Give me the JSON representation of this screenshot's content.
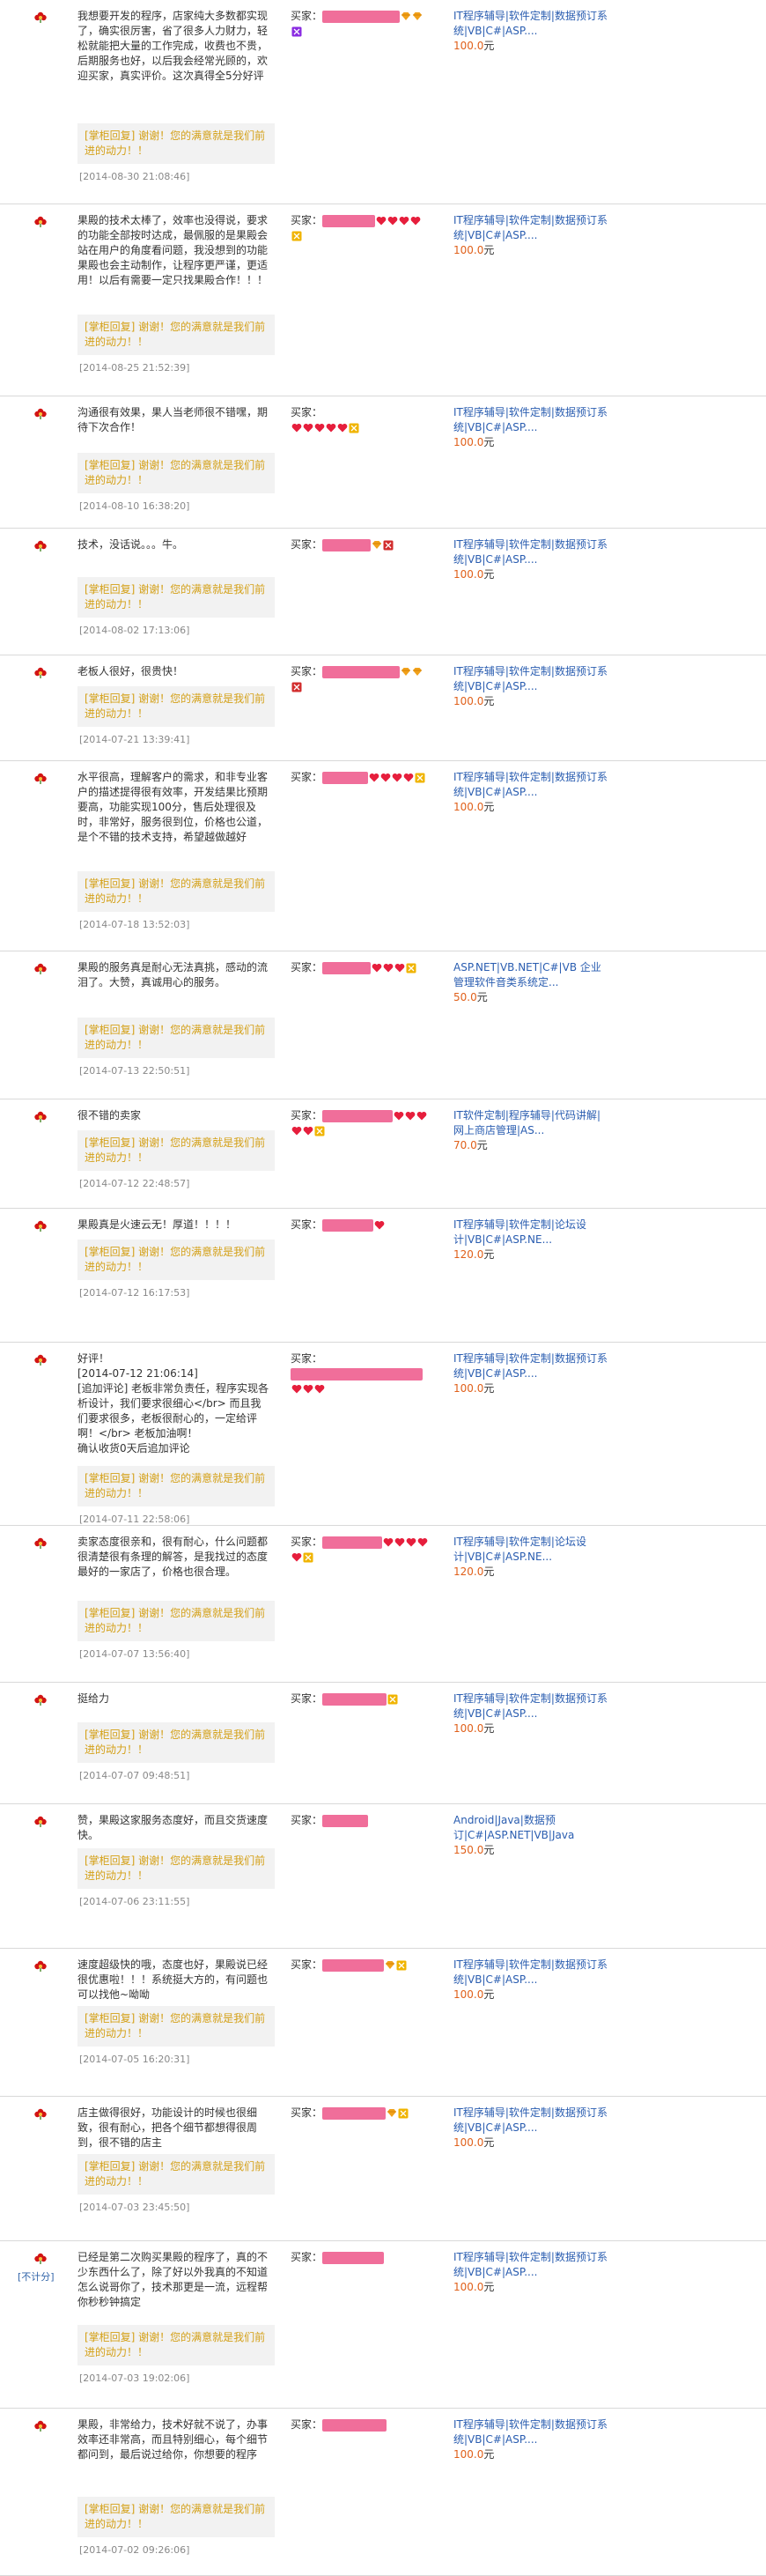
{
  "labels": {
    "buyer": "买家：",
    "price_unit": "元",
    "reply": "[掌柜回复] 谢谢！您的满意就是我们前进的动力！！"
  },
  "colors": {
    "rate_icon": "#cc1111",
    "mask": "#f06e9a",
    "reply_text": "#d4a017",
    "reply_bg": "#f2f2f2",
    "link": "#2a5db0",
    "price": "#e0601a",
    "divider": "#d9d9d9"
  },
  "reviews": [
    {
      "comment": "我想要开发的程序，店家纯大多数都实现了，确实很厉害，省了很多人力财力，轻松就能把大量的工作完成，收费也不贵，后期服务也好，以后我会经常光顾的，欢迎买家，真实评价。这次真得全5分好评",
      "date": "[2014-08-30 21:08:46]",
      "icons": [
        "diamond",
        "diamond",
        "badge-purple"
      ],
      "product": "IT程序辅导|软件定制|数据预订系统|VB|C#|ASP....",
      "price": "100.0"
    },
    {
      "comment": "果殿的技术太棒了，效率也没得说，要求的功能全部按时达成，最佩服的是果殿会站在用户的角度看问题，我没想到的功能果殿也会主动制作，让程序更严谨，更适用！以后有需要一定只找果殿合作！！！",
      "date": "[2014-08-25 21:52:39]",
      "icons": [
        "heart",
        "heart",
        "heart",
        "heart",
        "badge"
      ],
      "product": "IT程序辅导|软件定制|数据预订系统|VB|C#|ASP....",
      "price": "100.0"
    },
    {
      "comment": "沟通很有效果，果人当老师很不错嘿，期待下次合作！",
      "date": "[2014-08-10 16:38:20]",
      "icons": [
        "heart",
        "heart",
        "heart",
        "heart",
        "heart",
        "badge"
      ],
      "product": "IT程序辅导|软件定制|数据预订系统|VB|C#|ASP....",
      "price": "100.0"
    },
    {
      "comment": "技术，没话说。。。牛。",
      "date": "[2014-08-02 17:13:06]",
      "icons": [
        "diamond",
        "badge-red"
      ],
      "product": "IT程序辅导|软件定制|数据预订系统|VB|C#|ASP....",
      "price": "100.0"
    },
    {
      "comment": "老板人很好，很贵快！",
      "date": "[2014-07-21 13:39:41]",
      "icons": [
        "diamond",
        "diamond",
        "badge-red"
      ],
      "product": "IT程序辅导|软件定制|数据预订系统|VB|C#|ASP....",
      "price": "100.0"
    },
    {
      "comment": "水平很高，理解客户的需求，和非专业客户的描述提得很有效率，开发结果比预期要高，功能实现100分，售后处理很及时，非常好，服务很到位，价格也公道，是个不错的技术支持，希望越做越好",
      "date": "[2014-07-18 13:52:03]",
      "icons": [
        "heart",
        "heart",
        "heart",
        "heart",
        "badge"
      ],
      "product": "IT程序辅导|软件定制|数据预订系统|VB|C#|ASP....",
      "price": "100.0"
    },
    {
      "comment": "果殿的服务真是耐心无法真挑，感动的流泪了。大赞，真诚用心的服务。",
      "date": "[2014-07-13 22:50:51]",
      "icons": [
        "heart",
        "heart",
        "heart",
        "badge"
      ],
      "product": "ASP.NET|VB.NET|C#|VB 企业管理软件音类系统定...",
      "price": "50.0"
    },
    {
      "comment": "很不错的卖家",
      "date": "[2014-07-12 22:48:57]",
      "icons": [
        "heart",
        "heart",
        "heart",
        "heart",
        "heart",
        "badge"
      ],
      "product": "IT软件定制|程序辅导|代码讲解|网上商店管理|AS...",
      "price": "70.0"
    },
    {
      "comment": "果殿真是火速云无！厚道！！！！",
      "date": "[2014-07-12 16:17:53]",
      "icons": [
        "heart"
      ],
      "product": "IT程序辅导|软件定制|论坛设计|VB|C#|ASP.NE...",
      "price": "120.0"
    },
    {
      "comment": "好评！\n[2014-07-12 21:06:14]\n[追加评论] 老板非常负责任，程序实现各析设计，我们要求很细心</br> 而且我们要求很多，老板很耐心的，一定给评啊！</br> 老板加油啊！\n确认收货0天后追加评论",
      "date": "[2014-07-11 22:58:06]",
      "icons": [
        "heart",
        "heart",
        "heart"
      ],
      "product": "IT程序辅导|软件定制|数据预订系统|VB|C#|ASP....",
      "price": "100.0"
    },
    {
      "comment": "卖家态度很亲和，很有耐心，什么问题都很清楚很有条理的解答，是我找过的态度最好的一家店了，价格也很合理。",
      "date": "[2014-07-07 13:56:40]",
      "icons": [
        "heart",
        "heart",
        "heart",
        "heart",
        "heart",
        "badge"
      ],
      "product": "IT程序辅导|软件定制|论坛设计|VB|C#|ASP.NE...",
      "price": "120.0"
    },
    {
      "comment": "挺给力",
      "date": "[2014-07-07 09:48:51]",
      "icons": [
        "badge"
      ],
      "product": "IT程序辅导|软件定制|数据预订系统|VB|C#|ASP....",
      "price": "100.0"
    },
    {
      "comment": "赞，果殿这家服务态度好，而且交货速度快。",
      "date": "[2014-07-06 23:11:55]",
      "icons": [],
      "product": "Android|Java|数据预订|C#|ASP.NET|VB|Java",
      "price": "150.0"
    },
    {
      "comment": "速度超级快的哦，态度也好，果殿说已经很优惠啦！！！系统挺大方的，有问题也可以找他~呦呦",
      "date": "[2014-07-05 16:20:31]",
      "icons": [
        "diamond",
        "badge"
      ],
      "product": "IT程序辅导|软件定制|数据预订系统|VB|C#|ASP....",
      "price": "100.0"
    },
    {
      "comment": "店主做得很好，功能设计的时候也很细致，很有耐心，把各个细节都想得很周到，很不错的店主",
      "date": "[2014-07-03 23:45:50]",
      "icons": [
        "diamond",
        "badge"
      ],
      "product": "IT程序辅导|软件定制|数据预订系统|VB|C#|ASP....",
      "price": "100.0"
    },
    {
      "comment": "已经是第二次购买果殿的程序了，真的不少东西什么了，除了好以外我真的不知道怎么说哥你了，技术那更是一流，远程帮你秒秒钟搞定",
      "date": "[2014-07-03 19:02:06]",
      "icons": [],
      "rate_label": "[不计分]",
      "product": "IT程序辅导|软件定制|数据预订系统|VB|C#|ASP....",
      "price": "100.0"
    },
    {
      "comment": "果殿，非常给力，技术好就不说了，办事效率还非常高，而且特别细心，每个细节都问到，最后说过给你，你想要的程序",
      "date": "[2014-07-02 09:26:06]",
      "icons": [],
      "product": "IT程序辅导|软件定制|数据预订系统|VB|C#|ASP....",
      "price": "100.0"
    }
  ]
}
